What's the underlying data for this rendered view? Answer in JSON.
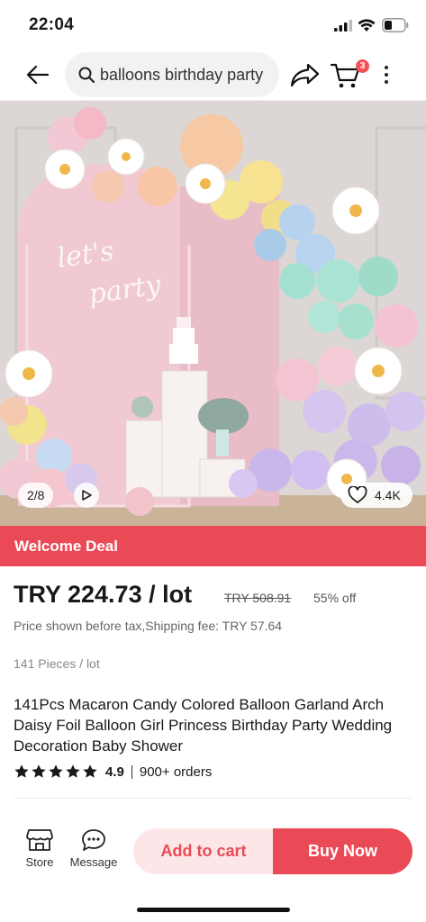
{
  "status_bar": {
    "time": "22:04"
  },
  "header": {
    "search_query": "balloons birthday party",
    "cart_badge": "3",
    "back_icon": "arrow-left-icon",
    "share_icon": "share-arrow-icon",
    "cart_icon": "cart-icon",
    "more_icon": "more-vertical-icon"
  },
  "gallery": {
    "image_text": "let's party",
    "pager": "2/8",
    "wishlist_count": "4.4K"
  },
  "deal": {
    "label": "Welcome Deal",
    "color": "#ea4a55"
  },
  "product": {
    "price": "TRY 224.73 / lot",
    "original_price": "TRY 508.91",
    "discount": "55% off",
    "tax_note": "Price shown before tax,Shipping fee: TRY 57.64",
    "pieces": "141 Pieces / lot",
    "title": "141Pcs Macaron Candy Colored Balloon Garland Arch Daisy Foil Balloon Girl Princess Birthday Party Wedding Decoration Baby Shower",
    "rating": "4.9",
    "rating_stars": 5,
    "orders": "900+ orders"
  },
  "bottom_bar": {
    "store_label": "Store",
    "message_label": "Message",
    "add_to_cart": "Add to cart",
    "buy_now": "Buy Now"
  },
  "colors": {
    "accent": "#ea4a55",
    "accent_light": "#fde6e7"
  }
}
